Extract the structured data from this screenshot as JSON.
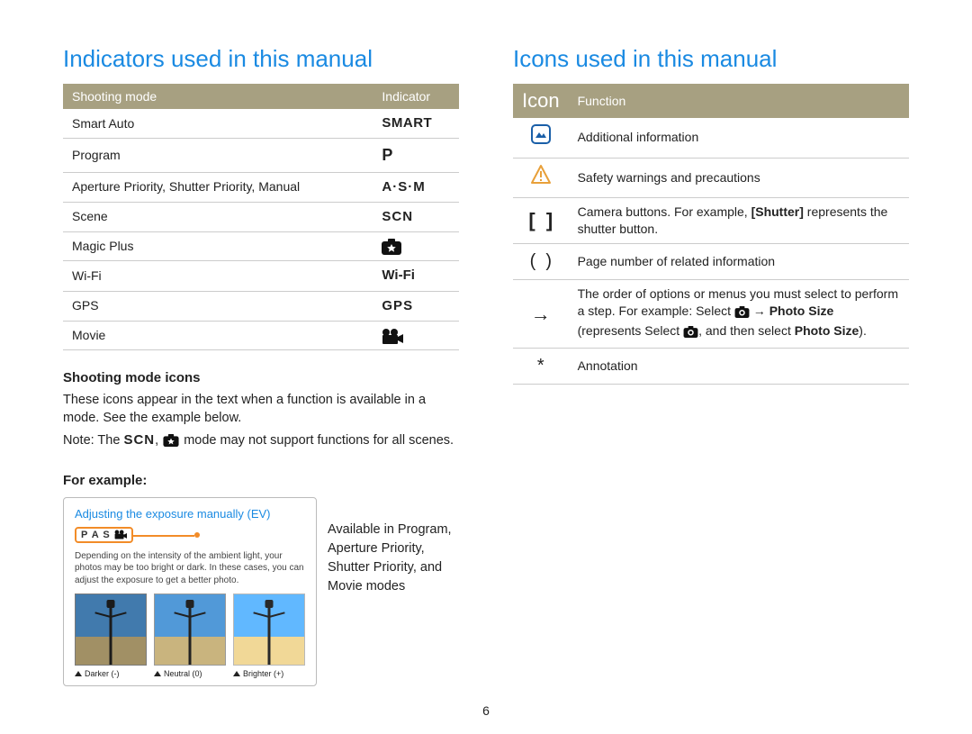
{
  "page_number": "6",
  "left": {
    "heading": "Indicators used in this manual",
    "table": {
      "headers": {
        "mode": "Shooting mode",
        "indicator": "Indicator"
      },
      "rows": [
        {
          "mode": "Smart Auto",
          "indicator": "SMART"
        },
        {
          "mode": "Program",
          "indicator": "P"
        },
        {
          "mode": "Aperture Priority, Shutter Priority, Manual",
          "indicator": "A·S·M"
        },
        {
          "mode": "Scene",
          "indicator": "SCN"
        },
        {
          "mode": "Magic Plus",
          "indicator": "magic-plus-icon"
        },
        {
          "mode": "Wi-Fi",
          "indicator": "Wi-Fi"
        },
        {
          "mode": "GPS",
          "indicator": "GPS"
        },
        {
          "mode": "Movie",
          "indicator": "movie-icon"
        }
      ]
    },
    "section_title": "Shooting mode icons",
    "section_body": "These icons appear in the text when a function is available in a mode. See the example below.",
    "note_prefix": "Note: The ",
    "note_suffix": " mode may not support functions for all scenes.",
    "for_example": "For example:",
    "example": {
      "title": "Adjusting the exposure manually (EV)",
      "badge_letters": "P A S",
      "desc": "Depending on the intensity of the ambient light, your photos may be too bright or dark. In these cases, you can adjust the exposure to get a better photo.",
      "captions": {
        "a": "Darker (-)",
        "b": "Neutral (0)",
        "c": "Brighter (+)"
      }
    },
    "legend": "Available in Program, Aperture Priority, Shutter Priority, and Movie modes"
  },
  "right": {
    "heading": "Icons used in this manual",
    "table": {
      "headers": {
        "icon": "Icon",
        "function": "Function"
      },
      "rows": {
        "additional": "Additional information",
        "safety": "Safety warnings and precautions",
        "buttons_a": "Camera buttons. For example, ",
        "buttons_brand": "[Shutter]",
        "buttons_b": " represents the shutter button.",
        "pageref": "Page number of related information",
        "order_a": "The order of options or menus you must select to perform a step. For example: Select ",
        "order_photo": "Photo Size",
        "order_b": " (represents Select ",
        "order_c": ", and then select ",
        "order_d": ").",
        "annotation": "Annotation"
      }
    }
  }
}
